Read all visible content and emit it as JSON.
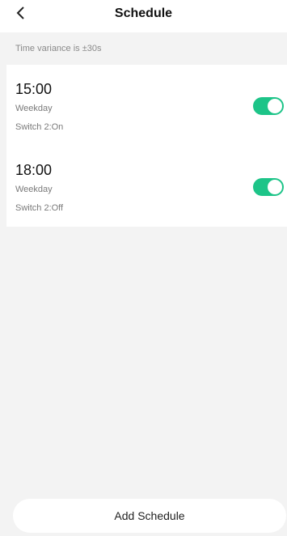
{
  "header": {
    "title": "Schedule",
    "back_icon": "chevron-left-icon"
  },
  "note": "Time variance is ±30s",
  "schedules": [
    {
      "time": "15:00",
      "repeat": "Weekday",
      "action": "Switch 2:On",
      "enabled": true
    },
    {
      "time": "18:00",
      "repeat": "Weekday",
      "action": "Switch 2:Off",
      "enabled": true
    }
  ],
  "add_button_label": "Add Schedule",
  "colors": {
    "toggle_on": "#1dc488",
    "background": "#f3f3f3",
    "card": "#ffffff"
  }
}
